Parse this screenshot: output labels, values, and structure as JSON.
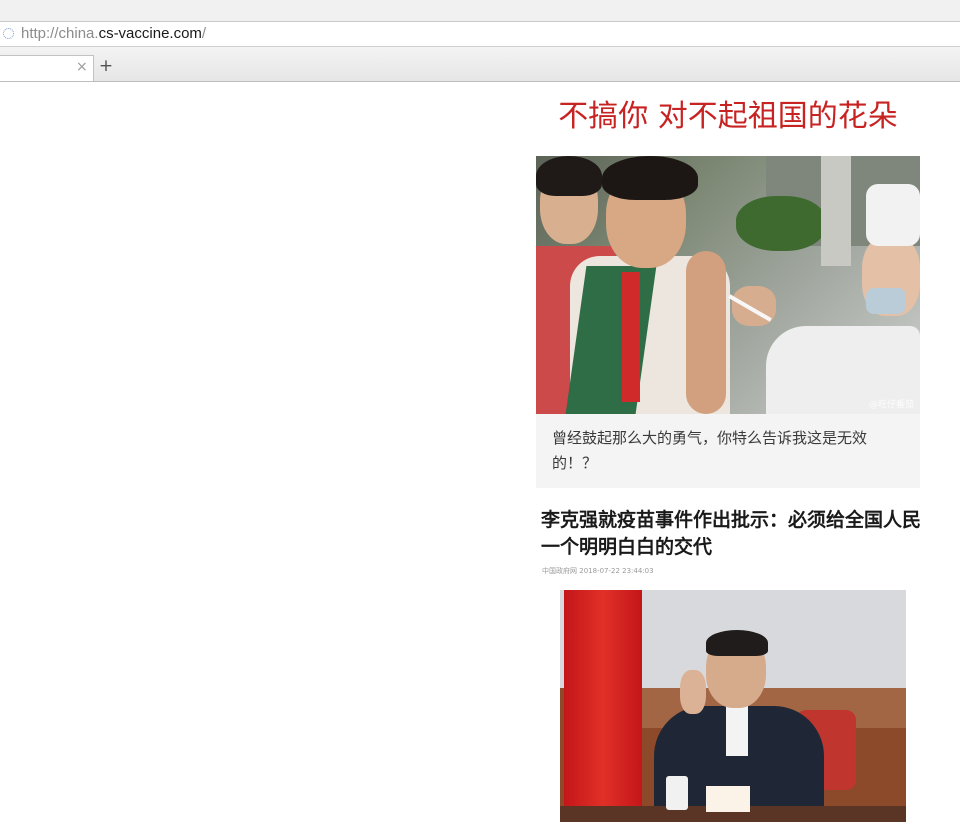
{
  "browser": {
    "url_scheme": "http://",
    "url_subdomain": "china.",
    "url_host": "cs-vaccine.com",
    "url_path": "/",
    "tab_close": "×",
    "new_tab": "+"
  },
  "page": {
    "banner": "不搞你  对不起祖国的花朵",
    "photo1_watermark": "@旺仔番茄",
    "photo1_caption": "曾经鼓起那么大的勇气，你特么告诉我这是无效的！？",
    "headline": "李克强就疫苗事件作出批示：必须给全国人民一个明明白白的交代",
    "byline_source": "中国政府网",
    "byline_time": "2018-07-22 23:44:03"
  }
}
